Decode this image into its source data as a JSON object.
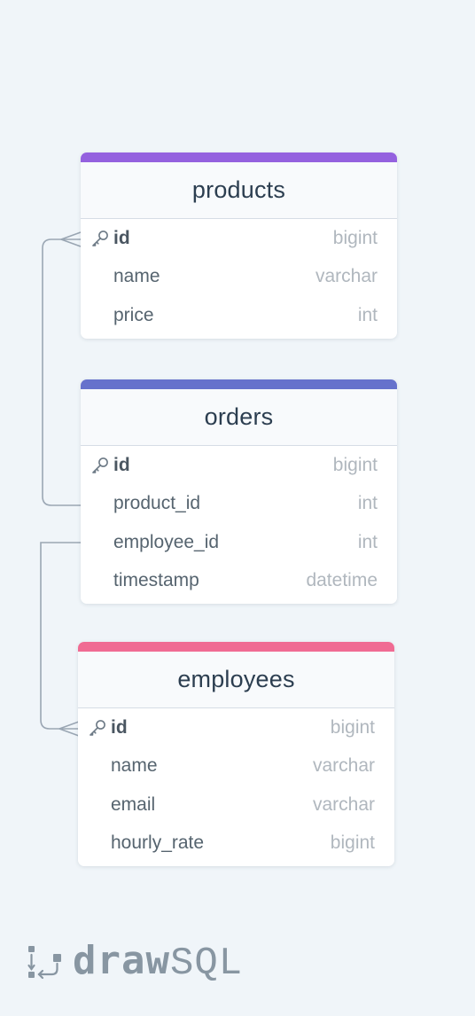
{
  "tables": [
    {
      "name": "products",
      "accent_color": "#9461df",
      "columns": [
        {
          "name": "id",
          "type": "bigint",
          "primary_key": true
        },
        {
          "name": "name",
          "type": "varchar",
          "primary_key": false
        },
        {
          "name": "price",
          "type": "int",
          "primary_key": false
        }
      ]
    },
    {
      "name": "orders",
      "accent_color": "#6672cc",
      "columns": [
        {
          "name": "id",
          "type": "bigint",
          "primary_key": true
        },
        {
          "name": "product_id",
          "type": "int",
          "primary_key": false
        },
        {
          "name": "employee_id",
          "type": "int",
          "primary_key": false
        },
        {
          "name": "timestamp",
          "type": "datetime",
          "primary_key": false
        }
      ]
    },
    {
      "name": "employees",
      "accent_color": "#f06b93",
      "columns": [
        {
          "name": "id",
          "type": "bigint",
          "primary_key": true
        },
        {
          "name": "name",
          "type": "varchar",
          "primary_key": false
        },
        {
          "name": "email",
          "type": "varchar",
          "primary_key": false
        },
        {
          "name": "hourly_rate",
          "type": "bigint",
          "primary_key": false
        }
      ]
    }
  ],
  "relationships": [
    {
      "from": "orders.product_id",
      "to": "products.id"
    },
    {
      "from": "orders.employee_id",
      "to": "employees.id"
    }
  ],
  "connector_color": "#9aa6b3",
  "logo": {
    "bold_text": "draw",
    "light_text": "SQL",
    "icon": "drawsql-logo-icon"
  }
}
